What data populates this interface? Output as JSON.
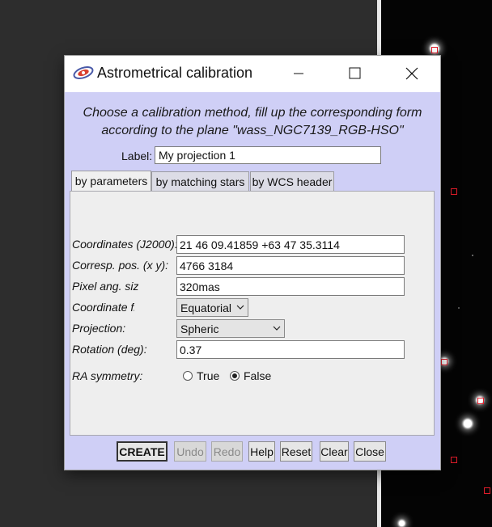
{
  "window": {
    "title": "Astrometrical calibration"
  },
  "instructions": {
    "line1": "Choose a calibration method, fill up the corresponding form",
    "line2": "according to the plane \"wass_NGC7139_RGB-HSO\""
  },
  "label_field": {
    "caption": "Label:",
    "value": "My projection 1"
  },
  "tabs": [
    {
      "label": "by parameters",
      "selected": true
    },
    {
      "label": "by matching stars",
      "selected": false
    },
    {
      "label": "by WCS header",
      "selected": false
    }
  ],
  "form": {
    "coordinates": {
      "label": "Coordinates (J2000):",
      "value": "21 46 09.41859 +63 47 35.3114"
    },
    "corresp_pos": {
      "label": "Corresp. pos. (x y):",
      "value": "4766 3184"
    },
    "pixel_size": {
      "label": "Pixel ang. size",
      "value": "320mas"
    },
    "coord_frame": {
      "label": "Coordinate frame",
      "value": "Equatorial"
    },
    "projection": {
      "label": "Projection:",
      "value": "Spheric"
    },
    "rotation": {
      "label": "Rotation (deg):",
      "value": "0.37"
    },
    "ra_symmetry": {
      "label": "RA symmetry:",
      "option_true": "True",
      "option_false": "False",
      "selected": "False"
    }
  },
  "buttons": {
    "create": "CREATE",
    "undo": "Undo",
    "redo": "Redo",
    "help": "Help",
    "reset": "Reset",
    "clear": "Clear",
    "close": "Close"
  },
  "colors": {
    "dialog_bg": "#cfcff6",
    "panel_bg": "#eeeeee",
    "marker": "#e01c2a"
  }
}
